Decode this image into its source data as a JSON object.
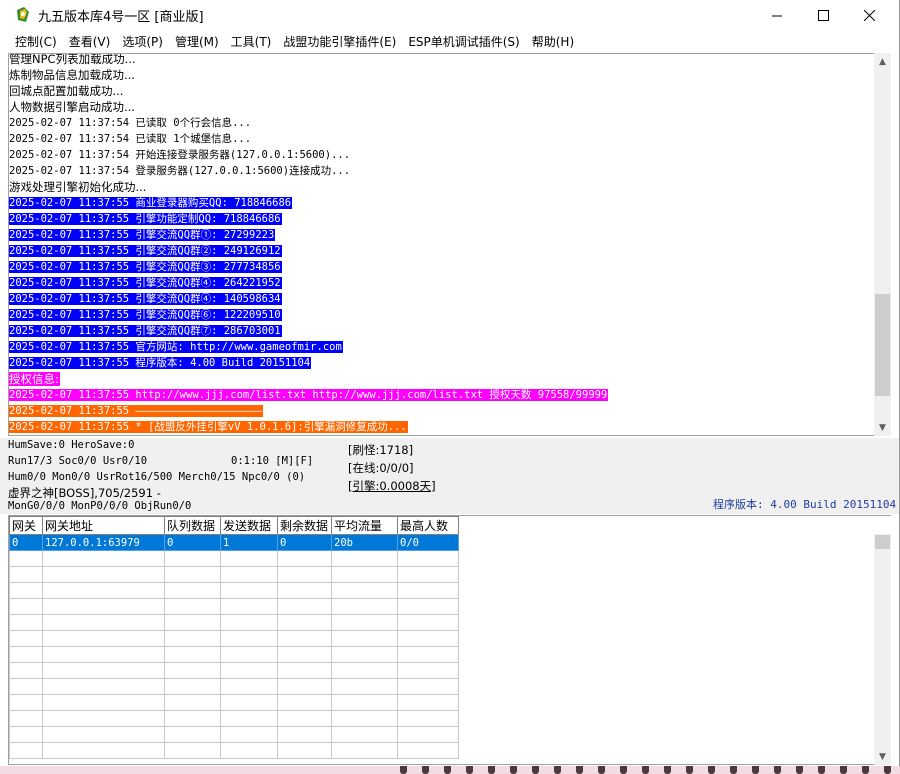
{
  "window": {
    "title": "九五版本库4号一区 [商业版]"
  },
  "menu": [
    {
      "label": "控制(C)"
    },
    {
      "label": "查看(V)"
    },
    {
      "label": "选项(P)"
    },
    {
      "label": "管理(M)"
    },
    {
      "label": "工具(T)"
    },
    {
      "label": "战盟功能引擎插件(E)"
    },
    {
      "label": "ESP单机调试插件(S)"
    },
    {
      "label": "帮助(H)"
    }
  ],
  "log": [
    {
      "text": "管理NPC列表加载成功...",
      "style": "plain"
    },
    {
      "text": "炼制物品信息加载成功...",
      "style": "plain"
    },
    {
      "text": "回城点配置加载成功...",
      "style": "plain"
    },
    {
      "text": "人物数据引擎启动成功...",
      "style": "plain"
    },
    {
      "text": "2025-02-07 11:37:54 已读取 0个行会信息...",
      "style": "plain"
    },
    {
      "text": "2025-02-07 11:37:54 已读取 1个城堡信息...",
      "style": "plain"
    },
    {
      "text": "2025-02-07 11:37:54 开始连接登录服务器(127.0.0.1:5600)...",
      "style": "plain"
    },
    {
      "text": "2025-02-07 11:37:54 登录服务器(127.0.0.1:5600)连接成功...",
      "style": "plain"
    },
    {
      "text": "游戏处理引擎初始化成功...",
      "style": "plain"
    },
    {
      "text": "2025-02-07 11:37:55 商业登录器购买QQ: 718846686",
      "style": "blue"
    },
    {
      "text": "2025-02-07 11:37:55 引擎功能定制QQ: 718846686",
      "style": "blue"
    },
    {
      "text": "2025-02-07 11:37:55 引擎交流QQ群①: 27299223",
      "style": "blue"
    },
    {
      "text": "2025-02-07 11:37:55 引擎交流QQ群②: 249126912",
      "style": "blue"
    },
    {
      "text": "2025-02-07 11:37:55 引擎交流QQ群③: 277734856",
      "style": "blue"
    },
    {
      "text": "2025-02-07 11:37:55 引擎交流QQ群④: 264221952",
      "style": "blue"
    },
    {
      "text": "2025-02-07 11:37:55 引擎交流QQ群④: 140598634",
      "style": "blue"
    },
    {
      "text": "2025-02-07 11:37:55 引擎交流QQ群⑥: 122209510",
      "style": "blue"
    },
    {
      "text": "2025-02-07 11:37:55 引擎交流QQ群⑦: 286703001",
      "style": "blue"
    },
    {
      "text": "2025-02-07 11:37:55 官方网站: http://www.gameofmir.com",
      "style": "blue"
    },
    {
      "text": "2025-02-07 11:37:55 程序版本: 4.00 Build 20151104",
      "style": "blue"
    },
    {
      "text": "授权信息:",
      "style": "magenta"
    },
    {
      "text": "2025-02-07 11:37:55 http://www.jjj.com/list.txt http://www.jjj.com/list.txt 授权天数 97558/99999",
      "style": "magenta"
    },
    {
      "text": "2025-02-07 11:37:55 ————————————————————",
      "style": "orange"
    },
    {
      "text": "2025-02-07 11:37:55 * [战盟反外挂引擎vV 1.0.1.6]:引擎漏洞修复成功...",
      "style": "orange"
    }
  ],
  "status": {
    "line1": "HumSave:0 HeroSave:0",
    "line2": "Run17/3 Soc0/0 Usr0/10",
    "time": "0:1:10 [M][F]",
    "line3": "Hum0/0 Mon0/0 UsrRot16/500 Merch0/15 Npc0/0 (0)",
    "line4": "虚界之神[BOSS],705/2591 -",
    "line5": "MonG0/0/0 MonP0/0/0 ObjRun0/0",
    "refresh": "[刷怪:1718]",
    "online": "[在线:0/0/0]",
    "engine": "[引擎:0.0008天]",
    "version": "程序版本: 4.00 Build 20151104"
  },
  "grid": {
    "columns": [
      "网关",
      "网关地址",
      "队列数据",
      "发送数据",
      "剩余数据",
      "平均流量",
      "最高人数"
    ],
    "rows": [
      [
        "0",
        "127.0.0.1:63979",
        "0",
        "1",
        "0",
        "20b",
        "0/0"
      ]
    ],
    "empty_rows": 13
  },
  "colors": {
    "highlight_blue": "#0000ff",
    "highlight_magenta": "#ff00ff",
    "highlight_orange": "#ff6600",
    "selection": "#0078d7",
    "version_text": "#1f3f9f"
  }
}
